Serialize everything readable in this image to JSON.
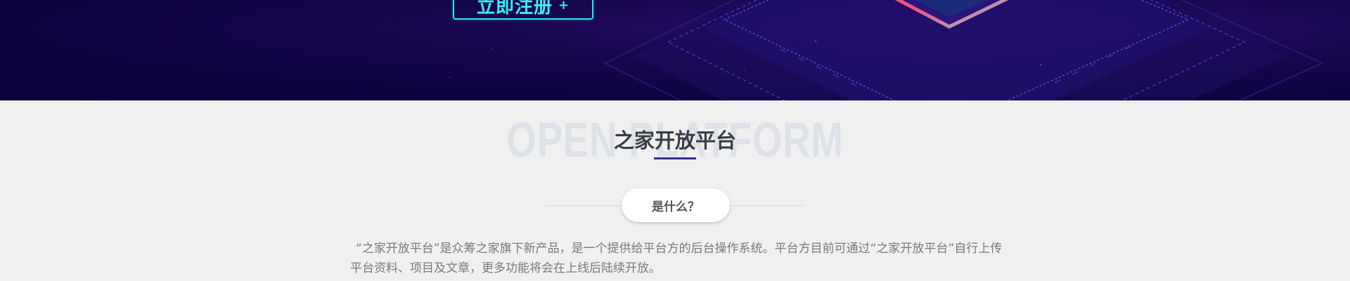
{
  "hero": {
    "register_label": "立即注册",
    "register_icon": "+"
  },
  "section": {
    "watermark": "OPEN PLATFORM",
    "title": "之家开放平台",
    "pill_label": "是什么？",
    "description": "“之家开放平台”是众筹之家旗下新产品，是一个提供给平台方的后台操作系统。平台方目前可通过“之家开放平台”自行上传平台资料、项目及文章，更多功能将会在上线后陆续开放。"
  },
  "colors": {
    "hero_bg": "#0f0440",
    "accent_cyan": "#2fe4e8",
    "underline": "#3c2a92",
    "page_bg": "#f0f0f0"
  }
}
